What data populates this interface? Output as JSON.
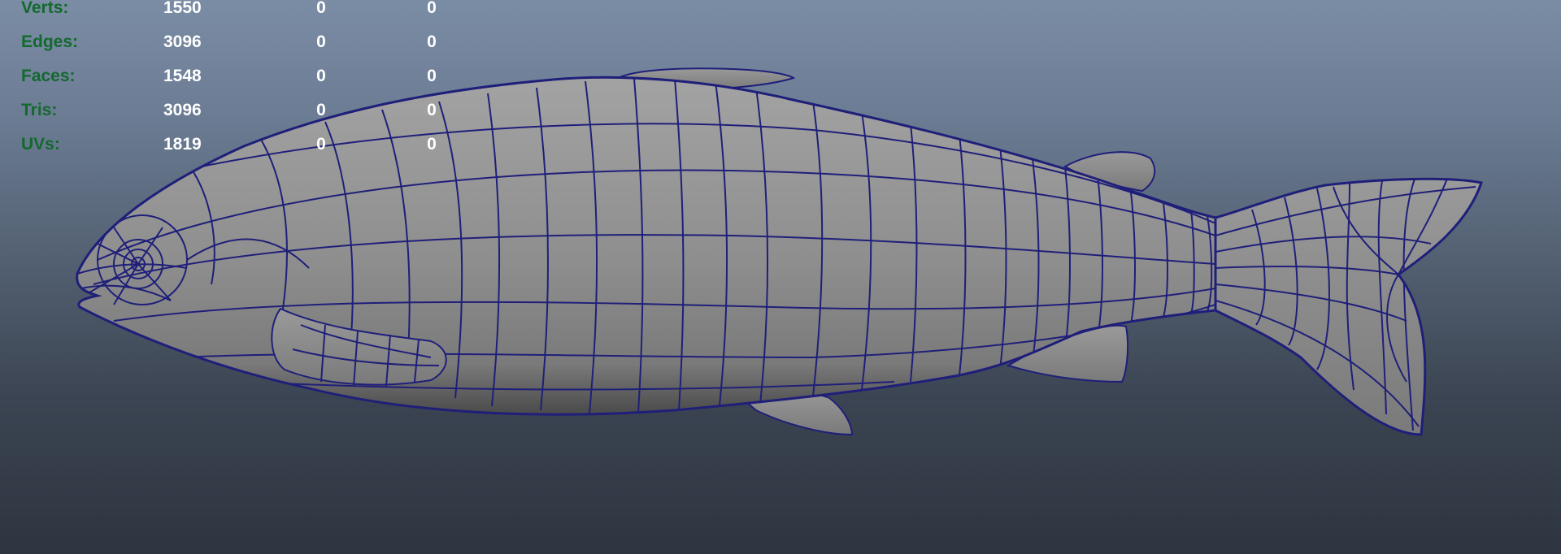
{
  "viewport": {
    "background_top": "#7b8ca5",
    "background_bottom": "#2e3540",
    "wire_color": "#1f1f7a",
    "mesh_fill": "#8a8a8a",
    "model_icon": "fish-mesh"
  },
  "hud": {
    "label_color": "#13692e",
    "value_color": "#ffffff",
    "rows": [
      {
        "label": "Verts:",
        "values": [
          "1550",
          "0",
          "0"
        ]
      },
      {
        "label": "Edges:",
        "values": [
          "3096",
          "0",
          "0"
        ]
      },
      {
        "label": "Faces:",
        "values": [
          "1548",
          "0",
          "0"
        ]
      },
      {
        "label": "Tris:",
        "values": [
          "3096",
          "0",
          "0"
        ]
      },
      {
        "label": "UVs:",
        "values": [
          "1819",
          "0",
          "0"
        ]
      }
    ]
  }
}
